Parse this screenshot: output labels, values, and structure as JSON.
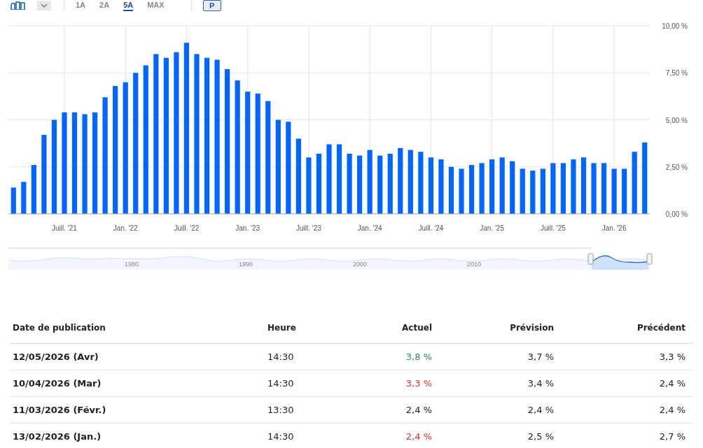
{
  "toolbar": {
    "periods": [
      {
        "label": "1A",
        "selected": false
      },
      {
        "label": "2A",
        "selected": false
      },
      {
        "label": "5A",
        "selected": true
      },
      {
        "label": "MAX",
        "selected": false
      }
    ],
    "p_button": {
      "label": "P",
      "selected": true
    }
  },
  "chart": {
    "chart_data": {
      "type": "bar",
      "grid": true,
      "series": [
        {
          "color": "#0066ff",
          "values": [
            1.4,
            1.7,
            2.6,
            4.2,
            5.0,
            5.4,
            5.4,
            5.3,
            5.4,
            6.2,
            6.8,
            7.0,
            7.5,
            7.9,
            8.5,
            8.3,
            8.6,
            9.1,
            8.5,
            8.3,
            8.2,
            7.7,
            7.1,
            6.5,
            6.4,
            6.0,
            5.0,
            4.9,
            4.0,
            3.0,
            3.2,
            3.7,
            3.7,
            3.2,
            3.1,
            3.4,
            3.1,
            3.2,
            3.5,
            3.4,
            3.3,
            3.0,
            2.9,
            2.5,
            2.4,
            2.6,
            2.7,
            2.9,
            3.0,
            2.8,
            2.4,
            2.3,
            2.4,
            2.7,
            2.7,
            2.9,
            3.0,
            2.7,
            2.7,
            2.4,
            2.4,
            3.3,
            3.8
          ]
        }
      ],
      "ylim": [
        0,
        10
      ],
      "yticks": [
        {
          "value": 0,
          "label": "0,00 %"
        },
        {
          "value": 2.5,
          "label": "2,50 %"
        },
        {
          "value": 5,
          "label": "5,00 %"
        },
        {
          "value": 7.5,
          "label": "7,50 %"
        },
        {
          "value": 10,
          "label": "10,00 %"
        }
      ],
      "categories": [
        null,
        null,
        null,
        null,
        null,
        "Juill. '21",
        null,
        null,
        null,
        null,
        null,
        "Jan. '22",
        null,
        null,
        null,
        null,
        null,
        "Juill. '22",
        null,
        null,
        null,
        null,
        null,
        "Jan. '23",
        null,
        null,
        null,
        null,
        null,
        "Juill. '23",
        null,
        null,
        null,
        null,
        null,
        "Jan. '24",
        null,
        null,
        null,
        null,
        null,
        "Juill. '24",
        null,
        null,
        null,
        null,
        null,
        "Jan. '25",
        null,
        null,
        null,
        null,
        null,
        "Juill. '25",
        null,
        null,
        null,
        null,
        null,
        "Jan. '26",
        null,
        null,
        null
      ]
    }
  },
  "navigator": {
    "year_labels": [
      "1980",
      "1990",
      "2000",
      "2010"
    ]
  },
  "table": {
    "columns": [
      "Date de publication",
      "Heure",
      "Actuel",
      "Prévision",
      "Précédent"
    ],
    "rows": [
      {
        "date": "12/05/2026 (Avr)",
        "time": "14:30",
        "actual": {
          "text": "3,8 %",
          "color": "#2f8a5a"
        },
        "forecast": "3,7 %",
        "previous": "3,3 %"
      },
      {
        "date": "10/04/2026 (Mar)",
        "time": "14:30",
        "actual": {
          "text": "3,3 %",
          "color": "#e0302b"
        },
        "forecast": "3,4 %",
        "previous": "2,4 %"
      },
      {
        "date": "11/03/2026 (Févr.)",
        "time": "13:30",
        "actual": {
          "text": "2,4 %",
          "color": "#222222"
        },
        "forecast": "2,4 %",
        "previous": "2,4 %"
      },
      {
        "date": "13/02/2026 (Jan.)",
        "time": "14:30",
        "actual": {
          "text": "2,4 %",
          "color": "#e0302b"
        },
        "forecast": "2,5 %",
        "previous": "2,7 %"
      }
    ]
  }
}
